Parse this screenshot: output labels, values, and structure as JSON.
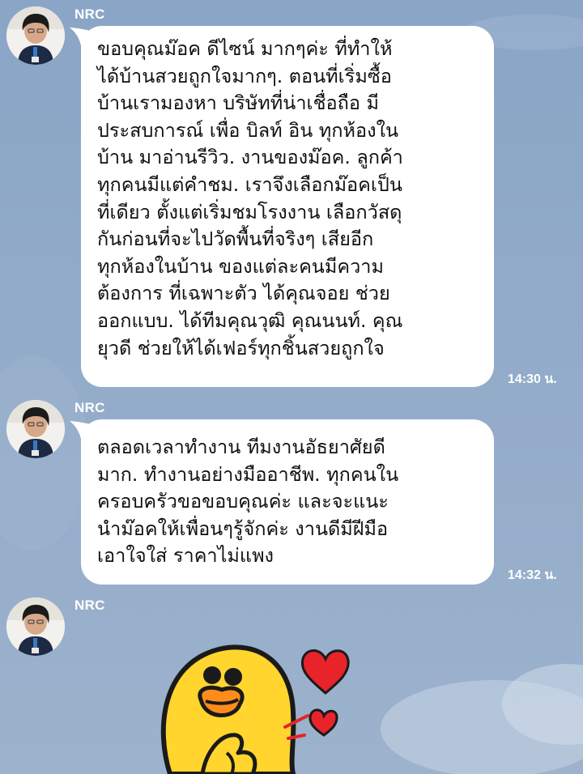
{
  "chat": {
    "messages": [
      {
        "sender": "NRC",
        "text": "ขอบคุณม๊อค ดีไซน์ มากๆค่ะ ที่ทำให้\nได้บ้านสวยถูกใจมากๆ. ตอนที่เริ่มซื้อ\nบ้านเรามองหา บริษัทที่น่าเชื่อถือ มี\nประสบการณ์ เพื่อ บิลท์ อิน ทุกห้องใน\nบ้าน มาอ่านรีวิว. งานของม๊อค. ลูกค้า\nทุกคนมีแต่คำชม. เราจึงเลือกม๊อคเป็น\nที่เดียว ตั้งแต่เริ่มชมโรงงาน เลือกวัสดุ\nกันก่อนที่จะไปวัดพื้นที่จริงๆ เสียอีก\nทุกห้องในบ้าน ของแต่ละคนมีความ\nต้องการ ที่เฉพาะตัว ได้คุณจอย ช่วย\nออกแบบ. ได้ทีมคุณวุฒิ คุณนนท์. คุณ\nยุวดี ช่วยให้ได้เฟอร์ทุกชิ้นสวยถูกใจ",
        "time": "14:30 น."
      },
      {
        "sender": "NRC",
        "text": "ตลอดเวลาทำงาน ทีมงานอัธยาศัยดี\nมาก. ทำงานอย่างมืออาชีพ. ทุกคนใน\nครอบครัวขอขอบคุณค่ะ และจะแนะ\nนำม๊อคให้เพื่อนๆรู้จักค่ะ  งานดีมีฝีมือ\nเอาใจใส่ ราคาไม่แพง",
        "time": "14:32 น."
      },
      {
        "sender": "NRC",
        "sticker": "duck-with-hearts-sticker"
      }
    ]
  },
  "colors": {
    "background": "#8ea8c8",
    "bubble": "#ffffff",
    "text": "#111111",
    "meta": "#ffffff",
    "sticker_yellow": "#ffd52e",
    "heart_red": "#e8232a"
  }
}
